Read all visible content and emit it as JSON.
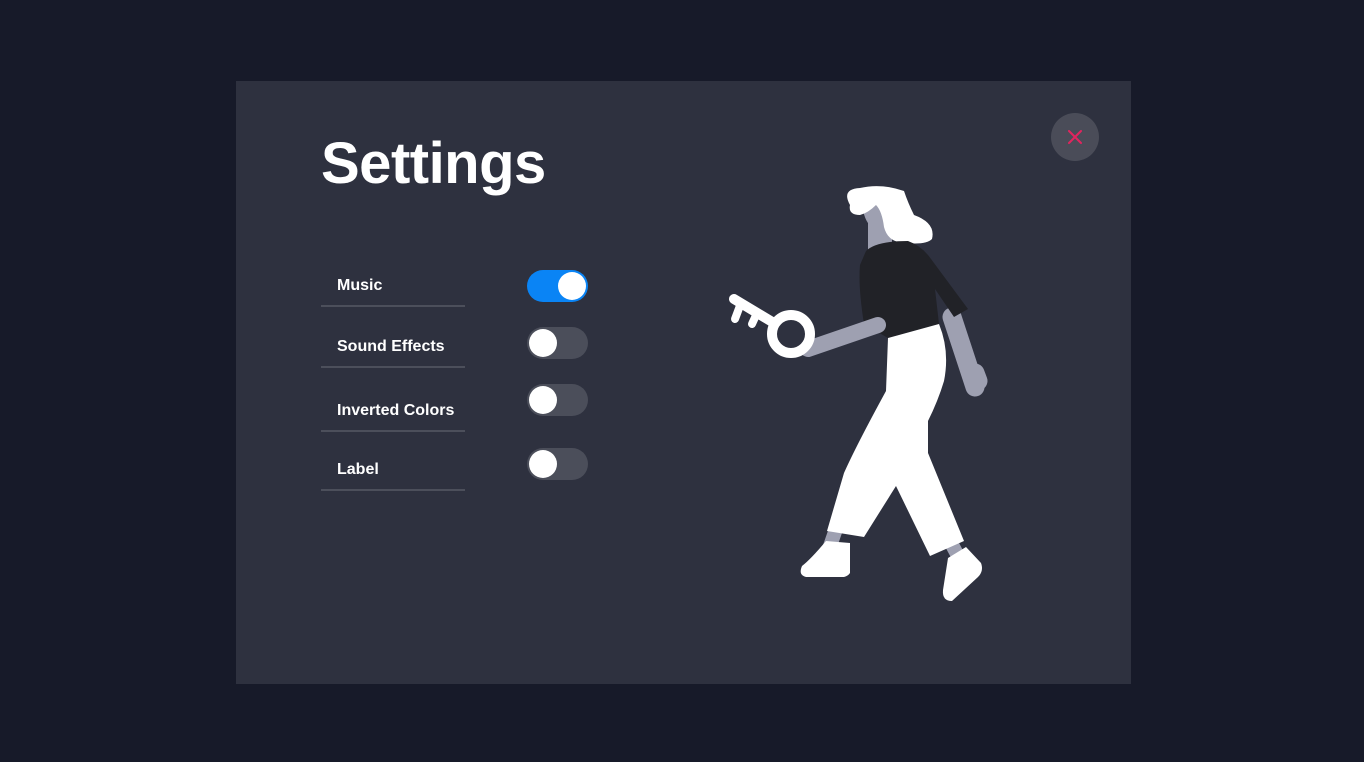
{
  "settings_panel": {
    "title": "Settings",
    "close_icon": "close-icon",
    "accent_color": "#0a84f5",
    "close_icon_color": "#e2245e",
    "options": [
      {
        "label": "Music",
        "enabled": true
      },
      {
        "label": "Sound Effects",
        "enabled": false
      },
      {
        "label": "Inverted Colors",
        "enabled": false
      },
      {
        "label": "Label",
        "enabled": false
      }
    ],
    "illustration": "woman-holding-key-illustration"
  }
}
